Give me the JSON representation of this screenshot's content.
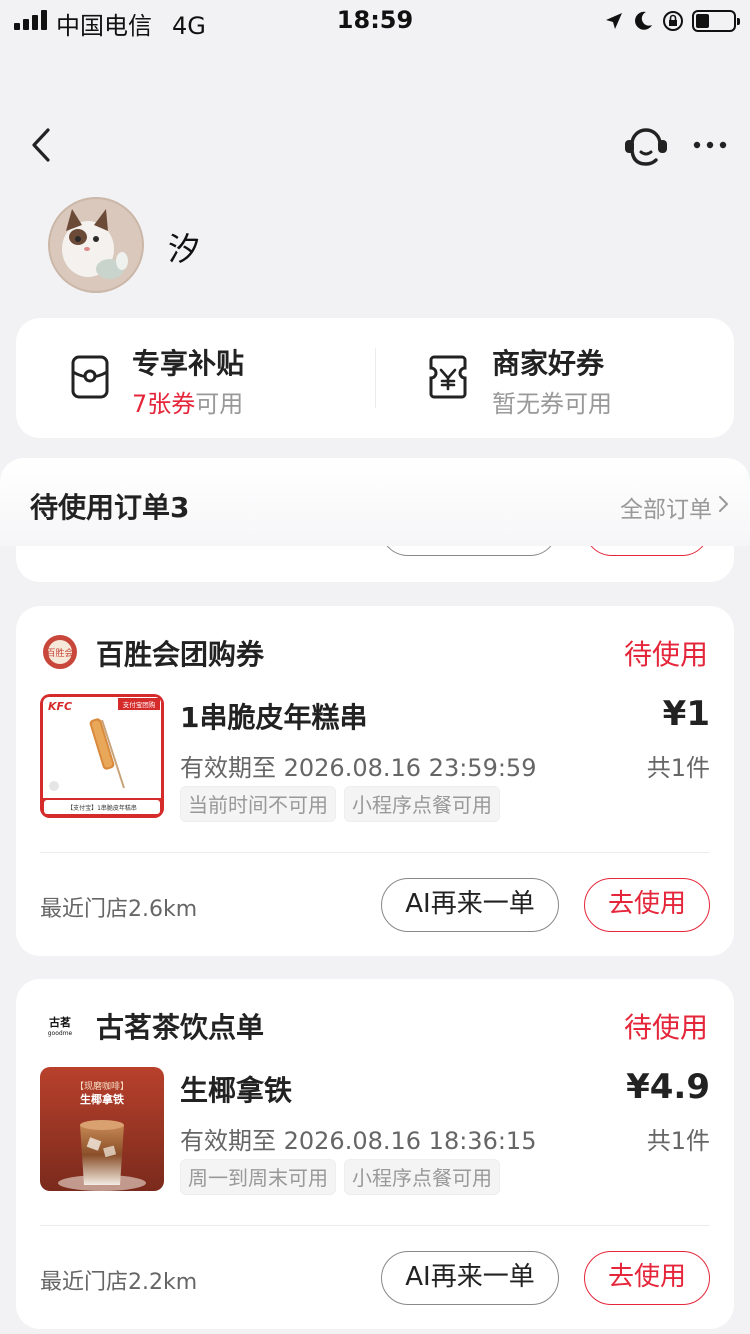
{
  "status_bar": {
    "carrier": "中国电信",
    "network": "4G",
    "time": "18:59",
    "battery_level": 0.35
  },
  "header": {
    "back_icon": "chevron-left-icon",
    "service_icon": "customer-service-icon",
    "more_icon": "more-dots-icon"
  },
  "profile": {
    "name": "汐"
  },
  "benefits": {
    "exclusive": {
      "title": "专享补贴",
      "count": "7张券",
      "suffix": "可用"
    },
    "merchant": {
      "title": "商家好券",
      "subtitle": "暂无券可用"
    }
  },
  "pending": {
    "title": "待使用订单3",
    "all_orders": "全部订单"
  },
  "orders": [
    {
      "merchant": "百胜会团购券",
      "logo_text": "百胜会",
      "status": "待使用",
      "item_name": "1串脆皮年糕串",
      "valid_until": "有效期至 2026.08.16 23:59:59",
      "price": "¥1",
      "quantity": "共1件",
      "tags": [
        "当前时间不可用",
        "小程序点餐可用"
      ],
      "thumb": {
        "brand": "KFC",
        "corner": "支付宝团购",
        "caption": "【支付宝】1串脆皮年糕串"
      },
      "nearest": "最近门店2.6km",
      "btn_ai": "AI再来一单",
      "btn_use": "去使用"
    },
    {
      "merchant": "古茗茶饮点单",
      "logo_text": "古茗",
      "logo_sub": "goodme",
      "status": "待使用",
      "item_name": "生椰拿铁",
      "valid_until": "有效期至 2026.08.16 18:36:15",
      "price": "¥4.9",
      "quantity": "共1件",
      "tags": [
        "周一到周末可用",
        "小程序点餐可用"
      ],
      "thumb": {
        "line1": "【现磨咖啡】",
        "line2": "生椰拿铁"
      },
      "nearest": "最近门店2.2km",
      "btn_ai": "AI再来一单",
      "btn_use": "去使用"
    }
  ],
  "colors": {
    "accent_red": "#e5263a",
    "background": "#f2f2f4"
  }
}
